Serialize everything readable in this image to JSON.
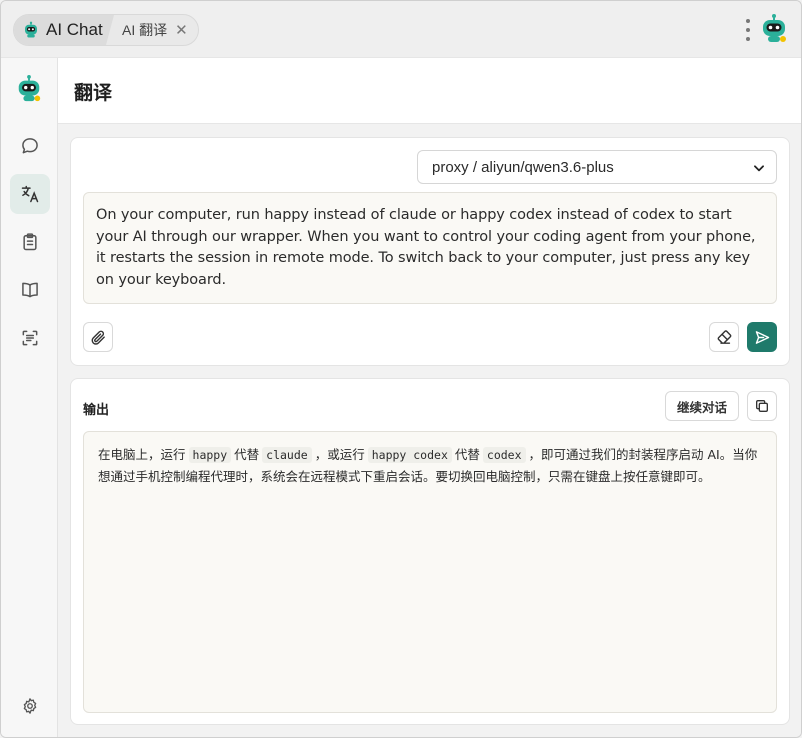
{
  "tabs": [
    {
      "label": "AI Chat"
    },
    {
      "label": "AI 翻译",
      "close": "✕"
    }
  ],
  "page": {
    "title": "翻译"
  },
  "translate": {
    "model": "proxy / aliyun/qwen3.6-plus",
    "input_text": "On your computer, run happy instead of claude or happy codex instead of codex to start your AI through our wrapper. When you want to control your coding agent from your phone, it restarts the session in remote mode. To switch back to your computer, just press any key on your keyboard."
  },
  "output": {
    "label": "输出",
    "continue_label": "继续对话",
    "segments": [
      {
        "text": "在电脑上，运行"
      },
      {
        "code": "happy"
      },
      {
        "text": "代替"
      },
      {
        "code": "claude"
      },
      {
        "text": "，或运行"
      },
      {
        "code": "happy codex"
      },
      {
        "text": "代替"
      },
      {
        "code": "codex"
      },
      {
        "text": "，即可通过我们的封装程序启动 AI。当你想通过手机控制编程代理时，系统会在远程模式下重启会话。要切换回电脑控制，只需在键盘上按任意键即可。"
      }
    ]
  },
  "sidebar": {
    "items": [
      {
        "icon": "chat-bubble-icon"
      },
      {
        "icon": "translate-icon",
        "active": true
      },
      {
        "icon": "clipboard-icon"
      },
      {
        "icon": "book-icon"
      },
      {
        "icon": "scan-text-icon"
      }
    ],
    "settings_icon": "gear-icon"
  },
  "colors": {
    "accent": "#1f7a6b",
    "robot": "#2bb09a"
  }
}
